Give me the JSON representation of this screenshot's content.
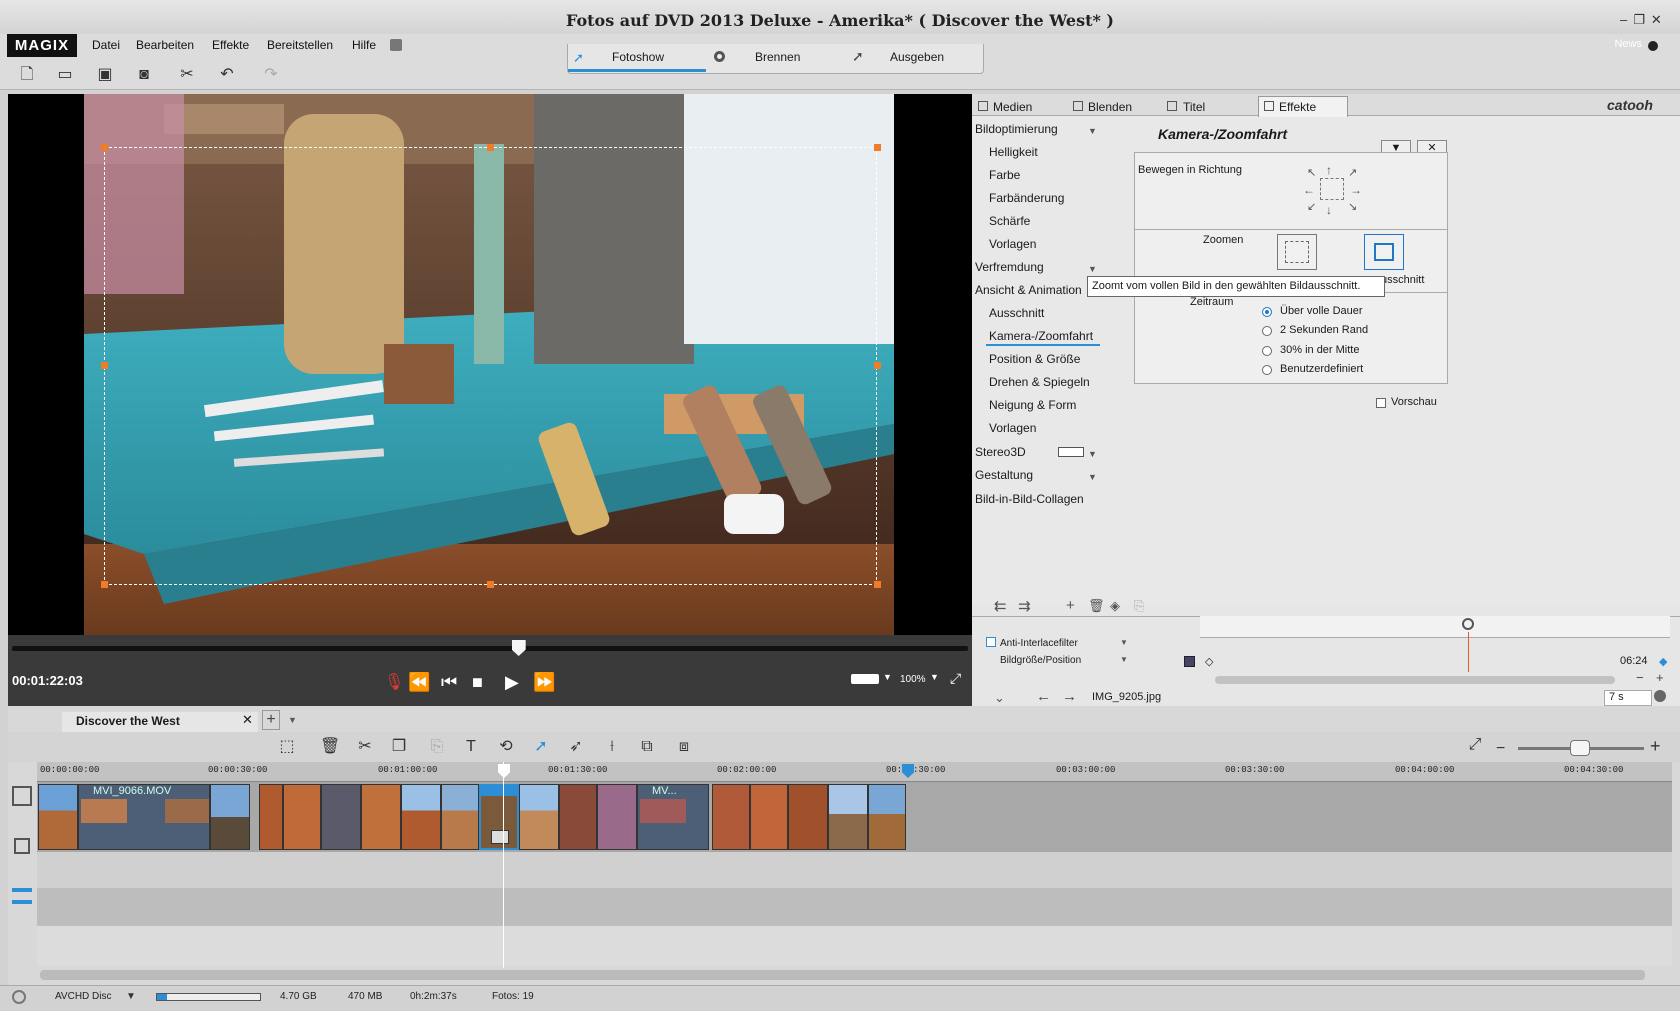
{
  "window": {
    "title": "Fotos auf DVD 2013 Deluxe - Amerika* ( Discover the West* )",
    "news": "News"
  },
  "menu": {
    "logo": "MAGIX",
    "items": [
      "Datei",
      "Bearbeiten",
      "Effekte",
      "Bereitstellen",
      "Hilfe"
    ]
  },
  "modes": {
    "tabs": [
      "Fotoshow",
      "Brennen",
      "Ausgeben"
    ],
    "active": "Fotoshow"
  },
  "preview": {
    "timecode": "00:01:22:03",
    "zoom": "100%",
    "scrub_progress": 0.53
  },
  "right_panel": {
    "tabs": [
      "Medien",
      "Blenden",
      "Titel",
      "Effekte"
    ],
    "brand": "catooh",
    "categories": [
      {
        "label": "Bildoptimierung",
        "items": [
          "Helligkeit",
          "Farbe",
          "Farbänderung",
          "Schärfe",
          "Vorlagen"
        ]
      },
      {
        "label": "Verfremdung",
        "items": []
      },
      {
        "label": "Ansicht & Animation",
        "items": [
          "Ausschnitt",
          "Kamera-/Zoomfahrt",
          "Position & Größe",
          "Drehen & Spiegeln",
          "Neigung & Form",
          "Vorlagen"
        ]
      },
      {
        "label": "Stereo3D",
        "items": []
      },
      {
        "label": "Gestaltung",
        "items": []
      },
      {
        "label": "Bild-in-Bild-Collagen",
        "items": []
      }
    ],
    "selected_item": "Kamera-/Zoomfahrt",
    "effect": {
      "title": "Kamera-/Zoomfahrt",
      "move_label": "Bewegen in Richtung",
      "zoom_label": "Zoomen",
      "zoom_suffix": "usschnitt",
      "time_label": "Zeitraum",
      "tooltip": "Zoomt vom vollen Bild in den gewählten Bildausschnitt.",
      "options": [
        "Über volle Dauer",
        "2 Sekunden Rand",
        "30% in der Mitte",
        "Benutzerdefiniert"
      ],
      "selected_option": "Über volle Dauer",
      "preview_label": "Vorschau"
    },
    "keyframes": {
      "rows": [
        "Anti-Interlacefilter",
        "Bildgröße/Position"
      ],
      "time": "06:24",
      "filename": "IMG_9205.jpg",
      "duration": "7 s"
    }
  },
  "timeline": {
    "project_tab": "Discover the West",
    "ruler": [
      "00:00:00:00",
      "00:00:30:00",
      "00:01:00:00",
      "00:01:30:00",
      "00:02:00:00",
      "00:02:30:00",
      "00:03:00:00",
      "00:03:30:00",
      "00:04:00:00",
      "00:04:30:00"
    ],
    "clip_labels": [
      "MVI_9066.MOV",
      "MV..."
    ]
  },
  "status": {
    "disc": "AVCHD Disc",
    "capacity": "4.70 GB",
    "used": "470 MB",
    "duration": "0h:2m:37s",
    "photos": "Fotos: 19",
    "fill": 0.1
  },
  "colors": {
    "accent": "#2c8fd6",
    "handle": "#f07c2a",
    "dark": "#3a3a3a"
  }
}
